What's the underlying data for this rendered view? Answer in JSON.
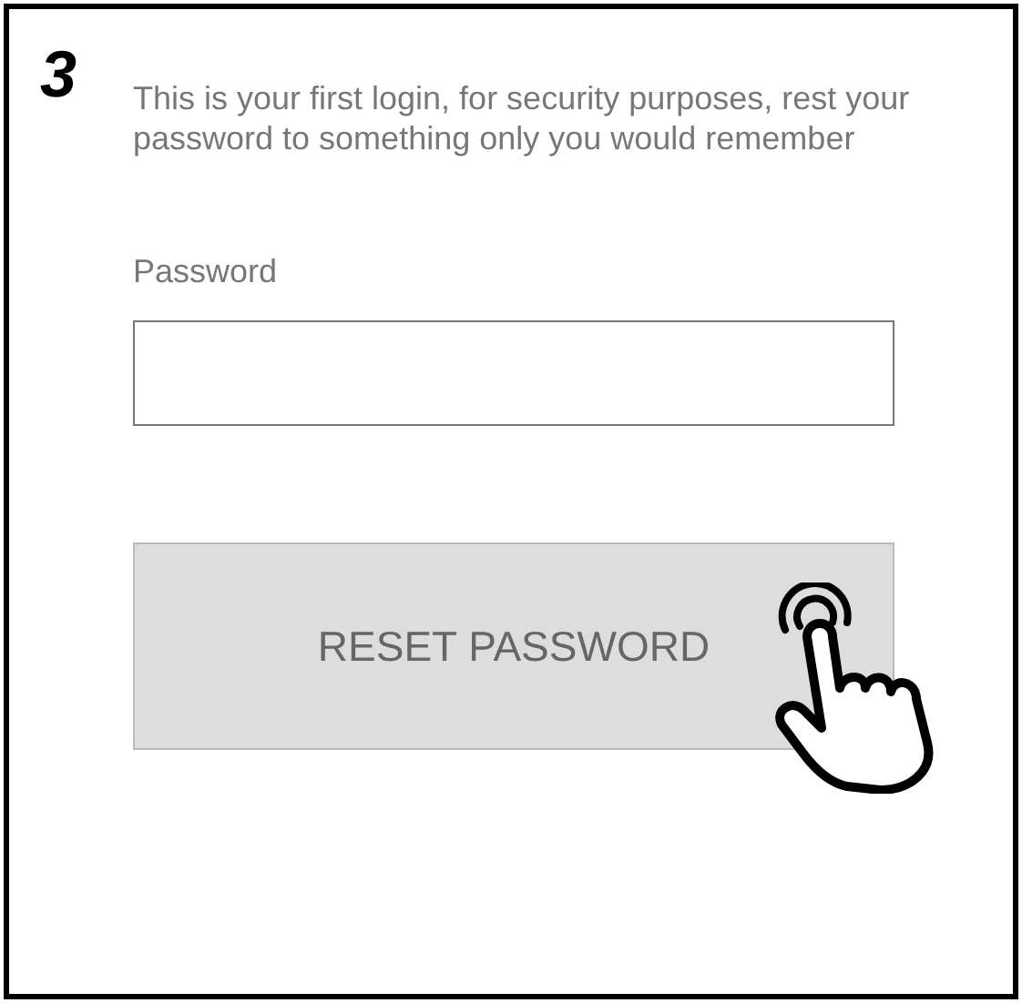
{
  "step": "3",
  "message": "This is your first login, for security purposes, rest your password to something only you would remember",
  "password_field": {
    "label": "Password"
  },
  "button": {
    "label": "RESET PASSWORD",
    "disabled": true
  }
}
